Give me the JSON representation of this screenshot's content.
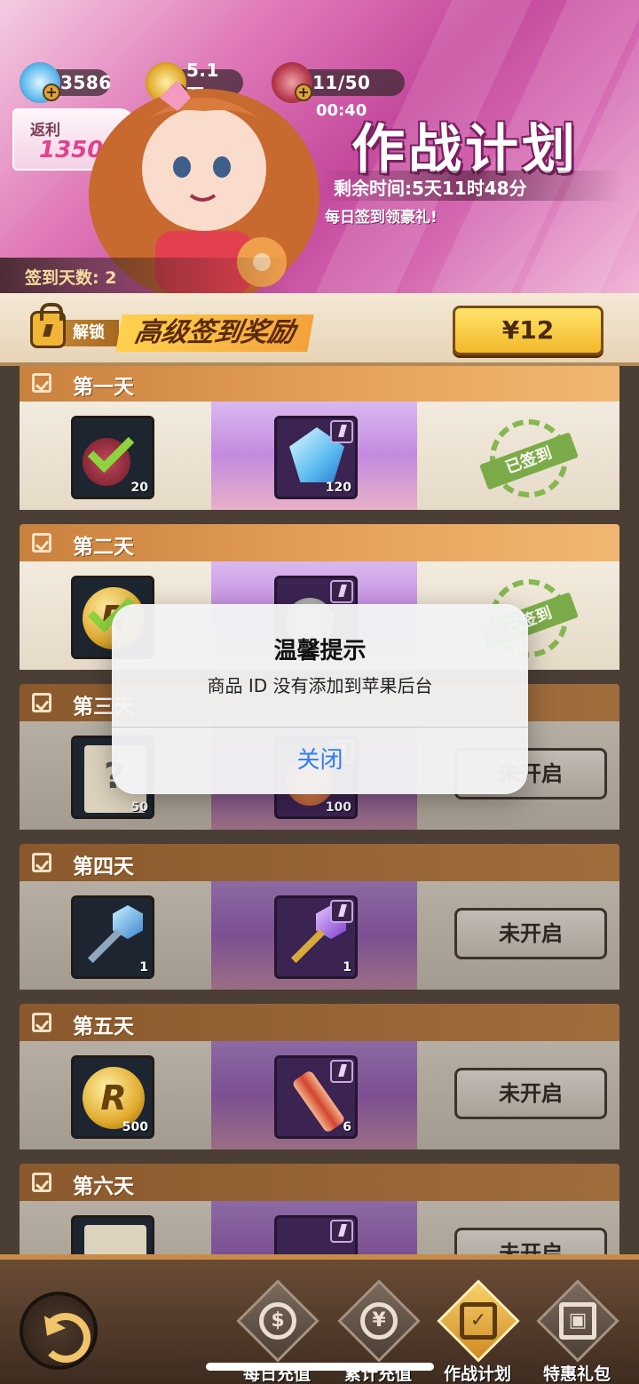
{
  "header": {
    "resources": [
      {
        "icon": "diamond-icon",
        "value": "3586"
      },
      {
        "icon": "coin-icon",
        "value": "5.1万"
      },
      {
        "icon": "meat-icon",
        "value": "11/50"
      }
    ],
    "rebate_label": "返利",
    "rebate_value": "1350%",
    "timer": "00:40",
    "title": "作战计划",
    "remaining": "剩余时间:5天11时48分",
    "daily_text": "每日签到领豪礼!",
    "sign_days": "签到天数: 2"
  },
  "unlock": {
    "tag": "解锁",
    "title": "高级签到奖励",
    "price": "¥12"
  },
  "days": [
    {
      "name": "第一天",
      "free_count": "20",
      "prem_count": "120",
      "status": "已签到",
      "claimed": true
    },
    {
      "name": "第二天",
      "free_count": "",
      "prem_count": "",
      "status": "已签到",
      "claimed": true
    },
    {
      "name": "第三天",
      "free_count": "50",
      "prem_count": "100",
      "status": "未开启",
      "claimed": false
    },
    {
      "name": "第四天",
      "free_count": "1",
      "prem_count": "1",
      "status": "未开启",
      "claimed": false
    },
    {
      "name": "第五天",
      "free_count": "500",
      "prem_count": "6",
      "status": "未开启",
      "claimed": false
    },
    {
      "name": "第六天",
      "free_count": "",
      "prem_count": "",
      "status": "未开启",
      "claimed": false
    }
  ],
  "alert": {
    "title": "温馨提示",
    "message": "商品 ID 没有添加到苹果后台",
    "button": "关闭"
  },
  "nav": {
    "tabs": [
      {
        "label": "每日充值",
        "icon": "dollar-icon"
      },
      {
        "label": "累计充值",
        "icon": "piggy-bank-icon"
      },
      {
        "label": "作战计划",
        "icon": "calendar-check-icon",
        "active": true
      },
      {
        "label": "特惠礼包",
        "icon": "gift-icon"
      }
    ]
  },
  "colors": {
    "accent": "#e0438d",
    "alert_button": "#2f7cf6",
    "claimed_stamp": "#6fa63a"
  }
}
